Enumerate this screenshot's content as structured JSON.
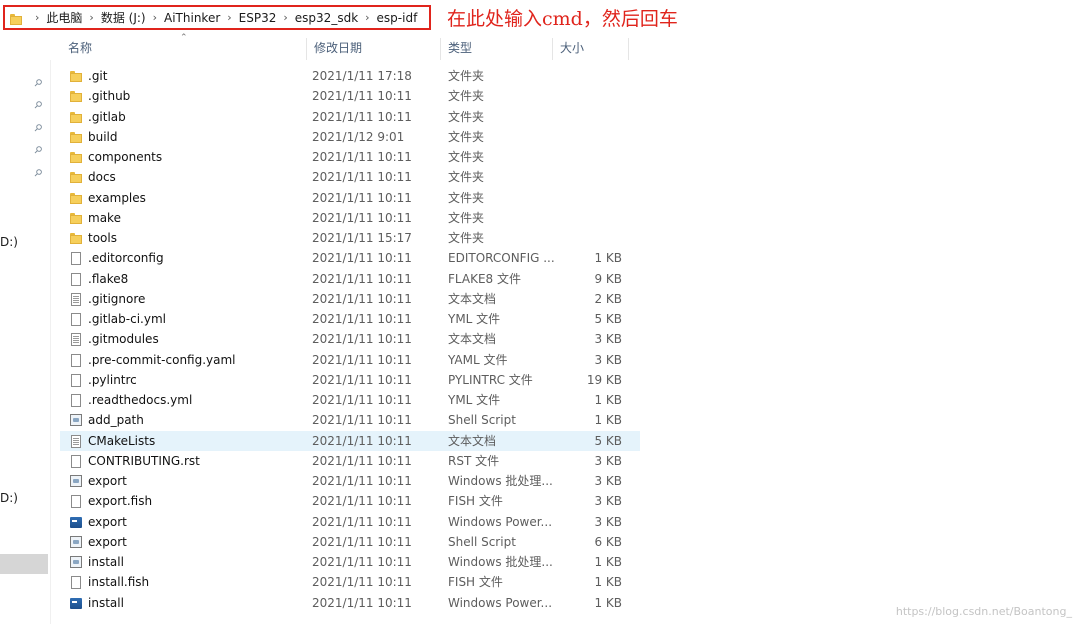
{
  "address_bar": {
    "breadcrumbs": [
      "此电脑",
      "数据 (J:)",
      "AiThinker",
      "ESP32",
      "esp32_sdk",
      "esp-idf"
    ],
    "annotation": "在此处输入cmd，然后回车"
  },
  "columns": {
    "name": "名称",
    "date": "修改日期",
    "type": "类型",
    "size": "大小"
  },
  "nav": {
    "drive1": "D:)",
    "drive2": "D:)"
  },
  "rows": [
    {
      "icon": "folder",
      "name": ".git",
      "date": "2021/1/11 17:18",
      "type": "文件夹",
      "size": ""
    },
    {
      "icon": "folder",
      "name": ".github",
      "date": "2021/1/11 10:11",
      "type": "文件夹",
      "size": ""
    },
    {
      "icon": "folder",
      "name": ".gitlab",
      "date": "2021/1/11 10:11",
      "type": "文件夹",
      "size": ""
    },
    {
      "icon": "folder",
      "name": "build",
      "date": "2021/1/12 9:01",
      "type": "文件夹",
      "size": ""
    },
    {
      "icon": "folder",
      "name": "components",
      "date": "2021/1/11 10:11",
      "type": "文件夹",
      "size": ""
    },
    {
      "icon": "folder",
      "name": "docs",
      "date": "2021/1/11 10:11",
      "type": "文件夹",
      "size": ""
    },
    {
      "icon": "folder",
      "name": "examples",
      "date": "2021/1/11 10:11",
      "type": "文件夹",
      "size": ""
    },
    {
      "icon": "folder",
      "name": "make",
      "date": "2021/1/11 10:11",
      "type": "文件夹",
      "size": ""
    },
    {
      "icon": "folder",
      "name": "tools",
      "date": "2021/1/11 15:17",
      "type": "文件夹",
      "size": ""
    },
    {
      "icon": "file",
      "name": ".editorconfig",
      "date": "2021/1/11 10:11",
      "type": "EDITORCONFIG ...",
      "size": "1 KB"
    },
    {
      "icon": "file",
      "name": ".flake8",
      "date": "2021/1/11 10:11",
      "type": "FLAKE8 文件",
      "size": "9 KB"
    },
    {
      "icon": "text",
      "name": ".gitignore",
      "date": "2021/1/11 10:11",
      "type": "文本文档",
      "size": "2 KB"
    },
    {
      "icon": "file",
      "name": ".gitlab-ci.yml",
      "date": "2021/1/11 10:11",
      "type": "YML 文件",
      "size": "5 KB"
    },
    {
      "icon": "text",
      "name": ".gitmodules",
      "date": "2021/1/11 10:11",
      "type": "文本文档",
      "size": "3 KB"
    },
    {
      "icon": "file",
      "name": ".pre-commit-config.yaml",
      "date": "2021/1/11 10:11",
      "type": "YAML 文件",
      "size": "3 KB"
    },
    {
      "icon": "file",
      "name": ".pylintrc",
      "date": "2021/1/11 10:11",
      "type": "PYLINTRC 文件",
      "size": "19 KB"
    },
    {
      "icon": "file",
      "name": ".readthedocs.yml",
      "date": "2021/1/11 10:11",
      "type": "YML 文件",
      "size": "1 KB"
    },
    {
      "icon": "script",
      "name": "add_path",
      "date": "2021/1/11 10:11",
      "type": "Shell Script",
      "size": "1 KB"
    },
    {
      "icon": "text",
      "name": "CMakeLists",
      "date": "2021/1/11 10:11",
      "type": "文本文档",
      "size": "5 KB",
      "selected": true
    },
    {
      "icon": "file",
      "name": "CONTRIBUTING.rst",
      "date": "2021/1/11 10:11",
      "type": "RST 文件",
      "size": "3 KB"
    },
    {
      "icon": "script",
      "name": "export",
      "date": "2021/1/11 10:11",
      "type": "Windows 批处理...",
      "size": "3 KB"
    },
    {
      "icon": "file",
      "name": "export.fish",
      "date": "2021/1/11 10:11",
      "type": "FISH 文件",
      "size": "3 KB"
    },
    {
      "icon": "ps",
      "name": "export",
      "date": "2021/1/11 10:11",
      "type": "Windows Power...",
      "size": "3 KB"
    },
    {
      "icon": "script",
      "name": "export",
      "date": "2021/1/11 10:11",
      "type": "Shell Script",
      "size": "6 KB"
    },
    {
      "icon": "script",
      "name": "install",
      "date": "2021/1/11 10:11",
      "type": "Windows 批处理...",
      "size": "1 KB"
    },
    {
      "icon": "file",
      "name": "install.fish",
      "date": "2021/1/11 10:11",
      "type": "FISH 文件",
      "size": "1 KB"
    },
    {
      "icon": "ps",
      "name": "install",
      "date": "2021/1/11 10:11",
      "type": "Windows Power...",
      "size": "1 KB"
    }
  ],
  "watermark": "https://blog.csdn.net/Boantong_"
}
